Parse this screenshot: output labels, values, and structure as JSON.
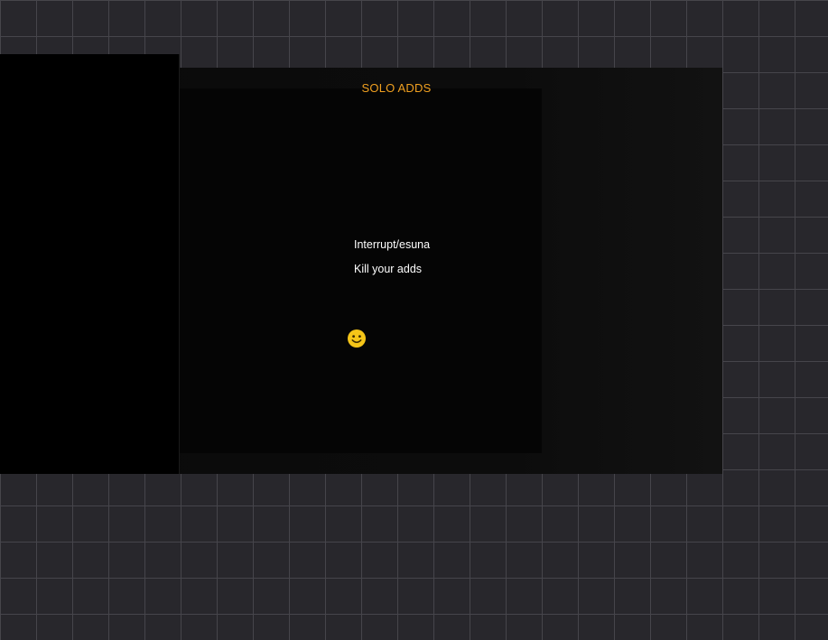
{
  "board": {
    "title": "SOLO ADDS",
    "lines": [
      "Interrupt/esuna",
      "Kill your adds"
    ],
    "marker_icon": "smiley-face-icon"
  },
  "colors": {
    "title": "#f0a020",
    "text": "#ffffff",
    "smiley": "#f5c518",
    "background": "#28272c",
    "grid": "#46454b"
  }
}
